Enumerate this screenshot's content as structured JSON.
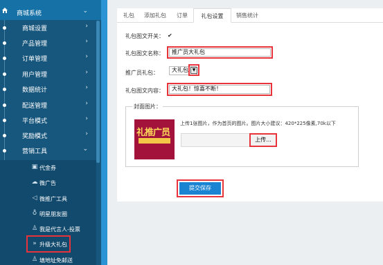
{
  "sidebar": {
    "title": "商城系统",
    "items": [
      {
        "label": "商城设置"
      },
      {
        "label": "产品管理"
      },
      {
        "label": "订单管理"
      },
      {
        "label": "用户管理"
      },
      {
        "label": "数据统计"
      },
      {
        "label": "配送管理"
      },
      {
        "label": "平台模式"
      },
      {
        "label": "奖励模式"
      },
      {
        "label": "营销工具"
      }
    ],
    "subitems": [
      {
        "label": "代金券"
      },
      {
        "label": "微广告"
      },
      {
        "label": "微推广工具"
      },
      {
        "label": "明星朋友圈"
      },
      {
        "label": "我是代言人-投票"
      },
      {
        "label": "升级大礼包"
      },
      {
        "label": "填地址免邮送"
      }
    ]
  },
  "tabs": [
    {
      "label": "礼包"
    },
    {
      "label": "添加礼包"
    },
    {
      "label": "订单"
    },
    {
      "label": "礼包设置"
    },
    {
      "label": "销售统计"
    }
  ],
  "form": {
    "switch_label": "礼包图文开关：",
    "switch_checked": "✔",
    "name_label": "礼包图文名称：",
    "name_value": "推广员大礼包",
    "promoter_label": "推广员礼包：",
    "promoter_selected": "大礼包",
    "content_label": "礼包图文内容：",
    "content_value": "大礼包！惊喜不断！",
    "cover_legend": "封面图片：",
    "upload_tip": "上传1张图片，作为首页的图片。图片大小建议：420*225像素,70k以下",
    "upload_button": "上传...",
    "submit_button": "提交保存"
  },
  "colors": {
    "sidebar_bg": "#18577d",
    "sidebar_sub_bg": "#114a6c",
    "accent": "#1a84d3",
    "highlight": "#e8333a"
  }
}
